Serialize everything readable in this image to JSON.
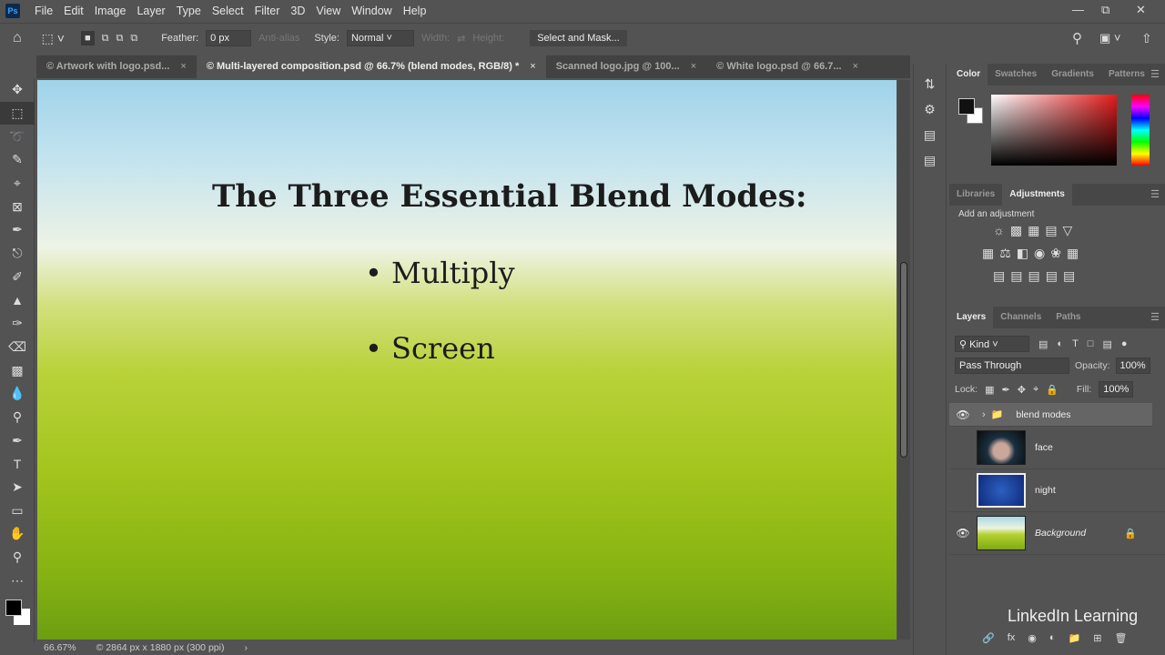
{
  "app": {
    "logo": "Ps"
  },
  "menu": [
    "File",
    "Edit",
    "Image",
    "Layer",
    "Type",
    "Select",
    "Filter",
    "3D",
    "View",
    "Window",
    "Help"
  ],
  "options": {
    "feather_label": "Feather:",
    "feather_value": "0 px",
    "antialias": "Anti-alias",
    "style_label": "Style:",
    "style_value": "Normal",
    "width_label": "Width:",
    "height_label": "Height:",
    "select_mask": "Select and Mask..."
  },
  "tabs": [
    {
      "label": "© Artwork with logo.psd...",
      "active": false
    },
    {
      "label": "© Multi-layered composition.psd @ 66.7% (blend modes, RGB/8) *",
      "active": true
    },
    {
      "label": "Scanned logo.jpg @ 100...",
      "active": false
    },
    {
      "label": "© White logo.psd @ 66.7...",
      "active": false
    }
  ],
  "canvas": {
    "title": "The Three Essential Blend Modes:",
    "bullets": [
      "• Multiply",
      "• Screen"
    ]
  },
  "status": {
    "zoom": "66.67%",
    "doc_info": "© 2864 px x 1880 px (300 ppi)"
  },
  "color_panel": {
    "tabs": [
      "Color",
      "Swatches",
      "Gradients",
      "Patterns"
    ]
  },
  "adjustments_panel": {
    "tabs": [
      "Libraries",
      "Adjustments"
    ],
    "hint": "Add an adjustment"
  },
  "layers_panel": {
    "tabs": [
      "Layers",
      "Channels",
      "Paths"
    ],
    "filter": "Kind",
    "blend_mode": "Pass Through",
    "opacity_label": "Opacity:",
    "opacity": "100%",
    "lock_label": "Lock:",
    "fill_label": "Fill:",
    "fill": "100%",
    "layers": [
      {
        "name": "blend modes",
        "type": "group",
        "visible": true
      },
      {
        "name": "face",
        "type": "pixel",
        "visible": false
      },
      {
        "name": "night",
        "type": "pixel",
        "visible": false
      },
      {
        "name": "Background",
        "type": "background",
        "visible": true,
        "locked": true
      }
    ]
  },
  "branding": "LinkedIn Learning"
}
